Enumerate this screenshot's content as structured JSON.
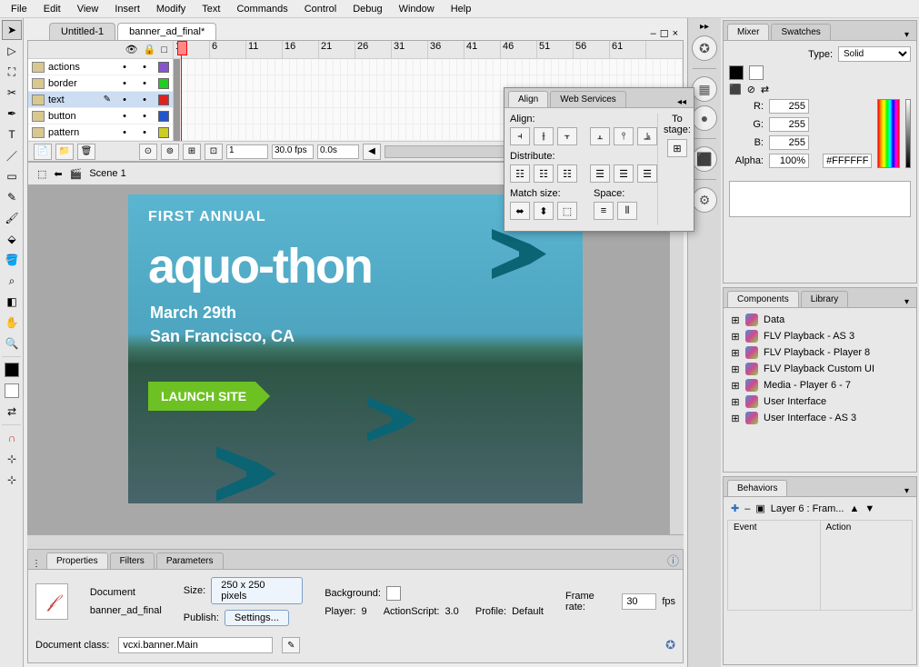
{
  "menu": [
    "File",
    "Edit",
    "View",
    "Insert",
    "Modify",
    "Text",
    "Commands",
    "Control",
    "Debug",
    "Window",
    "Help"
  ],
  "tabs": {
    "inactive": "Untitled-1",
    "active": "banner_ad_final*"
  },
  "layers": {
    "items": [
      {
        "name": "actions",
        "color": "#8855cc"
      },
      {
        "name": "border",
        "color": "#22cc22"
      },
      {
        "name": "text",
        "color": "#dd2222"
      },
      {
        "name": "button",
        "color": "#2255cc"
      },
      {
        "name": "pattern",
        "color": "#cccc22"
      }
    ],
    "selected_index": 2
  },
  "timeline": {
    "ruler_max": 65,
    "frame": "1",
    "fps": "30.0 fps",
    "elapsed": "0.0s"
  },
  "scene": {
    "name": "Scene 1"
  },
  "banner": {
    "subhead": "FIRST ANNUAL",
    "title": "aquo-thon",
    "date": "March 29th",
    "location": "San Francisco, CA",
    "button": "LAUNCH SITE"
  },
  "align": {
    "tab1": "Align",
    "tab2": "Web Services",
    "lbl_align": "Align:",
    "lbl_distribute": "Distribute:",
    "lbl_match": "Match size:",
    "lbl_space": "Space:",
    "lbl_tostage": "To stage:"
  },
  "properties": {
    "tab1": "Properties",
    "tab2": "Filters",
    "tab3": "Parameters",
    "doc_label": "Document",
    "doc_name": "banner_ad_final",
    "size_lbl": "Size:",
    "size_val": "250 x 250 pixels",
    "publish_lbl": "Publish:",
    "publish_val": "Settings...",
    "bg_lbl": "Background:",
    "player_lbl": "Player:",
    "player_val": "9",
    "as_lbl": "ActionScript:",
    "as_val": "3.0",
    "profile_lbl": "Profile:",
    "profile_val": "Default",
    "framerate_lbl": "Frame rate:",
    "framerate_val": "30",
    "fps_lbl": "fps",
    "docclass_lbl": "Document class:",
    "docclass_val": "vcxi.banner.Main"
  },
  "mixer": {
    "tab1": "Mixer",
    "tab2": "Swatches",
    "type_lbl": "Type:",
    "type_val": "Solid",
    "r_lbl": "R:",
    "r_val": "255",
    "g_lbl": "G:",
    "g_val": "255",
    "b_lbl": "B:",
    "b_val": "255",
    "alpha_lbl": "Alpha:",
    "alpha_val": "100%",
    "hex_val": "#FFFFFF"
  },
  "components": {
    "tab1": "Components",
    "tab2": "Library",
    "items": [
      "Data",
      "FLV Playback - AS 3",
      "FLV Playback - Player 8",
      "FLV Playback Custom UI",
      "Media - Player 6 - 7",
      "User Interface",
      "User Interface - AS 3"
    ]
  },
  "behaviors": {
    "tab": "Behaviors",
    "layer_lbl": "Layer 6 : Fram...",
    "col_event": "Event",
    "col_action": "Action"
  }
}
